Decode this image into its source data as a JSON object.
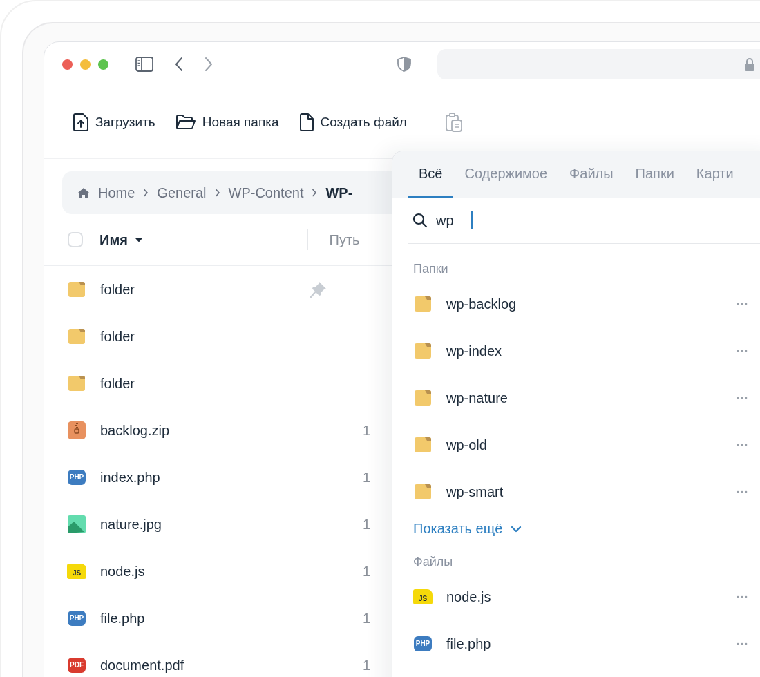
{
  "toolbar": [
    {
      "kind": "upload",
      "label": "Загрузить"
    },
    {
      "kind": "new-folder",
      "label": "Новая папка"
    },
    {
      "kind": "new-file",
      "label": "Создать файл"
    }
  ],
  "paste_button": {
    "disabled": true
  },
  "breadcrumb": [
    {
      "label": "Home",
      "current": false
    },
    {
      "label": "General",
      "current": false
    },
    {
      "label": "WP-Content",
      "current": false
    },
    {
      "label": "WP-",
      "current": true
    }
  ],
  "table": {
    "select_all": {
      "checked": false
    },
    "columns": [
      {
        "label": "Имя",
        "sorted": true
      },
      {
        "label": "Путь",
        "sorted": false
      }
    ],
    "rows": [
      {
        "kind": "folder",
        "name": "folder",
        "pinned": true
      },
      {
        "kind": "folder",
        "name": "folder",
        "pinned": false
      },
      {
        "kind": "folder",
        "name": "folder",
        "pinned": false
      },
      {
        "kind": "zip",
        "name": "backlog.zip",
        "pinned": false,
        "column_3": "1"
      },
      {
        "kind": "php",
        "badge": "PHP",
        "name": "index.php",
        "pinned": false,
        "column_3": "1"
      },
      {
        "kind": "image",
        "name": "nature.jpg",
        "pinned": false,
        "column_3": "1"
      },
      {
        "kind": "js",
        "badge": "JS",
        "name": "node.js",
        "pinned": false,
        "column_3": "1"
      },
      {
        "kind": "php",
        "badge": "PHP",
        "name": "file.php",
        "pinned": false,
        "column_3": "1"
      },
      {
        "kind": "pdf",
        "badge": "PDF",
        "name": "document.pdf",
        "pinned": false,
        "column_3": "1"
      }
    ]
  },
  "search_popover": {
    "tabs": [
      {
        "label": "Всё",
        "selected": true
      },
      {
        "label": "Содержимое",
        "selected": false
      },
      {
        "label": "Файлы",
        "selected": false
      },
      {
        "label": "Папки",
        "selected": false
      },
      {
        "label": "Карти",
        "selected": false
      }
    ],
    "search": {
      "value": "wp"
    },
    "sections": [
      {
        "title": "Папки",
        "show_more": "Показать ещё",
        "items": [
          {
            "kind": "folder",
            "name": "wp-backlog"
          },
          {
            "kind": "folder",
            "name": "wp-index"
          },
          {
            "kind": "folder",
            "name": "wp-nature"
          },
          {
            "kind": "folder",
            "name": "wp-old"
          },
          {
            "kind": "folder",
            "name": "wp-smart"
          }
        ]
      },
      {
        "title": "Файлы",
        "items": [
          {
            "kind": "js",
            "badge": "JS",
            "name": "node.js"
          },
          {
            "kind": "php",
            "badge": "PHP",
            "name": "file.php"
          }
        ]
      }
    ]
  }
}
